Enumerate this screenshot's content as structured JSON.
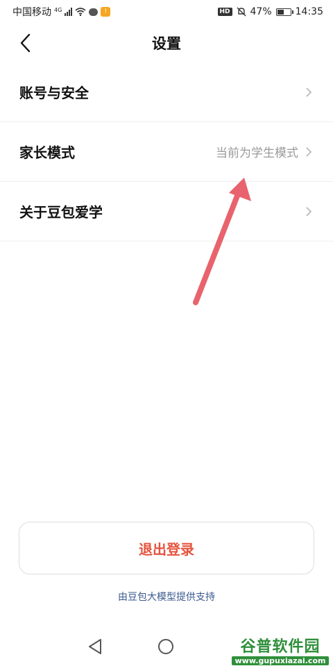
{
  "status_bar": {
    "carrier": "中国移动",
    "network": "4G",
    "battery": "47%",
    "battery_level": 0.47,
    "time": "14:35",
    "hd": "HD"
  },
  "header": {
    "title": "设置"
  },
  "settings": [
    {
      "label": "账号与安全",
      "value": ""
    },
    {
      "label": "家长模式",
      "value": "当前为学生模式"
    },
    {
      "label": "关于豆包爱学",
      "value": ""
    }
  ],
  "logout_label": "退出登录",
  "footer_text": "由豆包大模型提供支持",
  "watermark": {
    "name": "谷普软件园",
    "url": "www.gupuxiazai.com"
  },
  "colors": {
    "logout": "#e5533d",
    "footer_link": "#3a5a8f",
    "annotation": "#e8636d"
  }
}
